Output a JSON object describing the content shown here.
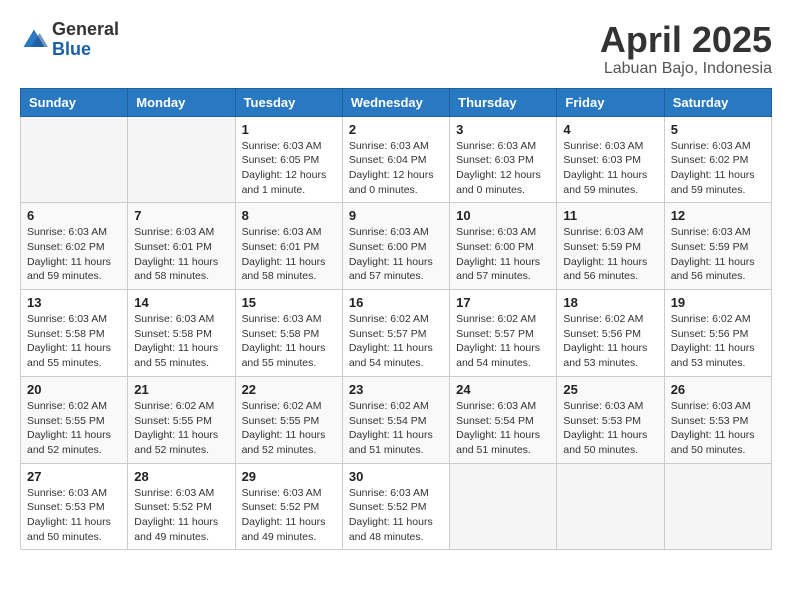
{
  "logo": {
    "general": "General",
    "blue": "Blue"
  },
  "title": "April 2025",
  "subtitle": "Labuan Bajo, Indonesia",
  "days_header": [
    "Sunday",
    "Monday",
    "Tuesday",
    "Wednesday",
    "Thursday",
    "Friday",
    "Saturday"
  ],
  "weeks": [
    [
      {
        "day": "",
        "info": ""
      },
      {
        "day": "",
        "info": ""
      },
      {
        "day": "1",
        "info": "Sunrise: 6:03 AM\nSunset: 6:05 PM\nDaylight: 12 hours\nand 1 minute."
      },
      {
        "day": "2",
        "info": "Sunrise: 6:03 AM\nSunset: 6:04 PM\nDaylight: 12 hours\nand 0 minutes."
      },
      {
        "day": "3",
        "info": "Sunrise: 6:03 AM\nSunset: 6:03 PM\nDaylight: 12 hours\nand 0 minutes."
      },
      {
        "day": "4",
        "info": "Sunrise: 6:03 AM\nSunset: 6:03 PM\nDaylight: 11 hours\nand 59 minutes."
      },
      {
        "day": "5",
        "info": "Sunrise: 6:03 AM\nSunset: 6:02 PM\nDaylight: 11 hours\nand 59 minutes."
      }
    ],
    [
      {
        "day": "6",
        "info": "Sunrise: 6:03 AM\nSunset: 6:02 PM\nDaylight: 11 hours\nand 59 minutes."
      },
      {
        "day": "7",
        "info": "Sunrise: 6:03 AM\nSunset: 6:01 PM\nDaylight: 11 hours\nand 58 minutes."
      },
      {
        "day": "8",
        "info": "Sunrise: 6:03 AM\nSunset: 6:01 PM\nDaylight: 11 hours\nand 58 minutes."
      },
      {
        "day": "9",
        "info": "Sunrise: 6:03 AM\nSunset: 6:00 PM\nDaylight: 11 hours\nand 57 minutes."
      },
      {
        "day": "10",
        "info": "Sunrise: 6:03 AM\nSunset: 6:00 PM\nDaylight: 11 hours\nand 57 minutes."
      },
      {
        "day": "11",
        "info": "Sunrise: 6:03 AM\nSunset: 5:59 PM\nDaylight: 11 hours\nand 56 minutes."
      },
      {
        "day": "12",
        "info": "Sunrise: 6:03 AM\nSunset: 5:59 PM\nDaylight: 11 hours\nand 56 minutes."
      }
    ],
    [
      {
        "day": "13",
        "info": "Sunrise: 6:03 AM\nSunset: 5:58 PM\nDaylight: 11 hours\nand 55 minutes."
      },
      {
        "day": "14",
        "info": "Sunrise: 6:03 AM\nSunset: 5:58 PM\nDaylight: 11 hours\nand 55 minutes."
      },
      {
        "day": "15",
        "info": "Sunrise: 6:03 AM\nSunset: 5:58 PM\nDaylight: 11 hours\nand 55 minutes."
      },
      {
        "day": "16",
        "info": "Sunrise: 6:02 AM\nSunset: 5:57 PM\nDaylight: 11 hours\nand 54 minutes."
      },
      {
        "day": "17",
        "info": "Sunrise: 6:02 AM\nSunset: 5:57 PM\nDaylight: 11 hours\nand 54 minutes."
      },
      {
        "day": "18",
        "info": "Sunrise: 6:02 AM\nSunset: 5:56 PM\nDaylight: 11 hours\nand 53 minutes."
      },
      {
        "day": "19",
        "info": "Sunrise: 6:02 AM\nSunset: 5:56 PM\nDaylight: 11 hours\nand 53 minutes."
      }
    ],
    [
      {
        "day": "20",
        "info": "Sunrise: 6:02 AM\nSunset: 5:55 PM\nDaylight: 11 hours\nand 52 minutes."
      },
      {
        "day": "21",
        "info": "Sunrise: 6:02 AM\nSunset: 5:55 PM\nDaylight: 11 hours\nand 52 minutes."
      },
      {
        "day": "22",
        "info": "Sunrise: 6:02 AM\nSunset: 5:55 PM\nDaylight: 11 hours\nand 52 minutes."
      },
      {
        "day": "23",
        "info": "Sunrise: 6:02 AM\nSunset: 5:54 PM\nDaylight: 11 hours\nand 51 minutes."
      },
      {
        "day": "24",
        "info": "Sunrise: 6:03 AM\nSunset: 5:54 PM\nDaylight: 11 hours\nand 51 minutes."
      },
      {
        "day": "25",
        "info": "Sunrise: 6:03 AM\nSunset: 5:53 PM\nDaylight: 11 hours\nand 50 minutes."
      },
      {
        "day": "26",
        "info": "Sunrise: 6:03 AM\nSunset: 5:53 PM\nDaylight: 11 hours\nand 50 minutes."
      }
    ],
    [
      {
        "day": "27",
        "info": "Sunrise: 6:03 AM\nSunset: 5:53 PM\nDaylight: 11 hours\nand 50 minutes."
      },
      {
        "day": "28",
        "info": "Sunrise: 6:03 AM\nSunset: 5:52 PM\nDaylight: 11 hours\nand 49 minutes."
      },
      {
        "day": "29",
        "info": "Sunrise: 6:03 AM\nSunset: 5:52 PM\nDaylight: 11 hours\nand 49 minutes."
      },
      {
        "day": "30",
        "info": "Sunrise: 6:03 AM\nSunset: 5:52 PM\nDaylight: 11 hours\nand 48 minutes."
      },
      {
        "day": "",
        "info": ""
      },
      {
        "day": "",
        "info": ""
      },
      {
        "day": "",
        "info": ""
      }
    ]
  ]
}
